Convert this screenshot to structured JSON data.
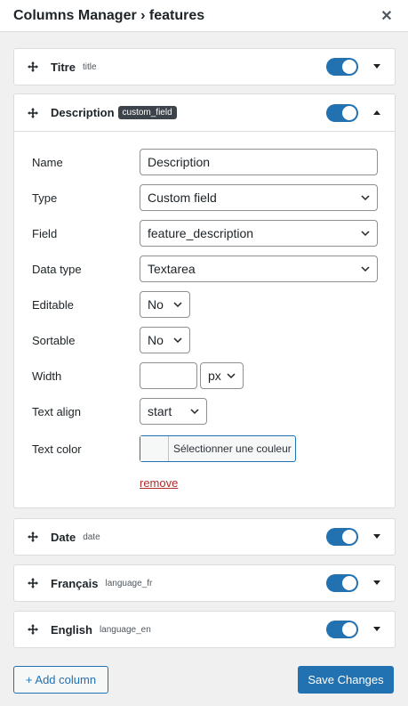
{
  "header": {
    "title": "Columns Manager › features",
    "close_glyph": "✕"
  },
  "columns": [
    {
      "label": "Titre",
      "type": "title",
      "enabled": true
    },
    {
      "label": "Description",
      "type": "custom_field",
      "enabled": true,
      "expanded": true
    },
    {
      "label": "Date",
      "type": "date",
      "enabled": true
    },
    {
      "label": "Français",
      "type": "language_fr",
      "enabled": true
    },
    {
      "label": "English",
      "type": "language_en",
      "enabled": true
    }
  ],
  "form": {
    "name_label": "Name",
    "name_value": "Description",
    "type_label": "Type",
    "type_value": "Custom field",
    "field_label": "Field",
    "field_value": "feature_description",
    "datatype_label": "Data type",
    "datatype_value": "Textarea",
    "editable_label": "Editable",
    "editable_value": "No",
    "sortable_label": "Sortable",
    "sortable_value": "No",
    "width_label": "Width",
    "width_value": "",
    "width_unit": "px",
    "align_label": "Text align",
    "align_value": "start",
    "color_label": "Text color",
    "color_button": "Sélectionner une couleur",
    "remove": "remove"
  },
  "footer": {
    "add_label": "+ Add column",
    "save_label": "Save Changes"
  },
  "colors": {
    "accent": "#2271b1",
    "danger": "#b32d2e",
    "badge": "#3c434a"
  }
}
